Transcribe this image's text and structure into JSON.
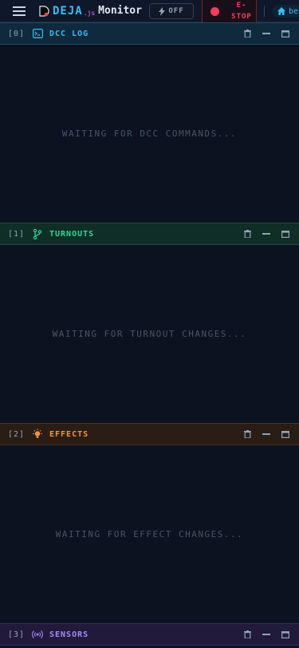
{
  "app": {
    "brand": "DEJA",
    "brand_suffix": ".js",
    "page_title": "Monitor"
  },
  "toolbar": {
    "power_label": "OFF",
    "estop_label": "E-\nSTOP",
    "layout_chip": "be"
  },
  "panels": [
    {
      "index": "[0]",
      "title": "DCC LOG",
      "icon": "terminal-icon",
      "empty_message": "WAITING FOR DCC COMMANDS...",
      "color": "#38bdf8"
    },
    {
      "index": "[1]",
      "title": "TURNOUTS",
      "icon": "git-branch-icon",
      "empty_message": "WAITING FOR TURNOUT CHANGES...",
      "color": "#34d399"
    },
    {
      "index": "[2]",
      "title": "EFFECTS",
      "icon": "lightbulb-icon",
      "empty_message": "WAITING FOR EFFECT CHANGES...",
      "color": "#fb923c"
    },
    {
      "index": "[3]",
      "title": "SENSORS",
      "icon": "broadcast-icon",
      "empty_message": "",
      "color": "#a78bfa"
    }
  ],
  "colors": {
    "background": "#0c1220",
    "estop": "#f43f5e",
    "accent": "#38bdf8"
  }
}
